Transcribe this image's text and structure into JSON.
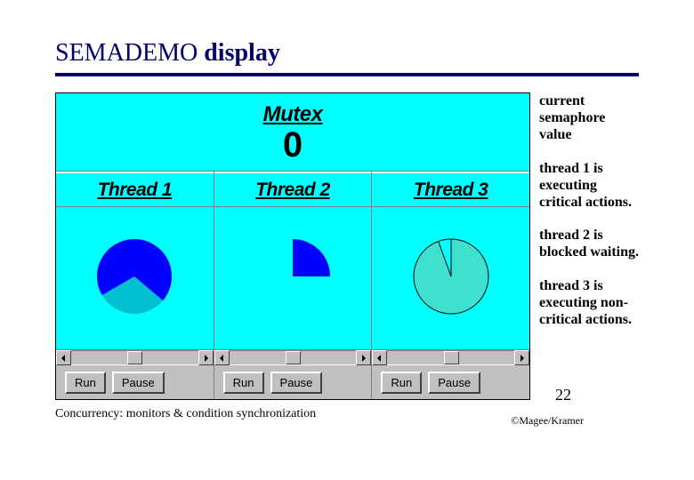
{
  "title": {
    "prefix": "SEMADEMO",
    "suffix": " display"
  },
  "mutex": {
    "label": "Mutex",
    "value": "0"
  },
  "threads": [
    {
      "name": "Thread 1",
      "run": "Run",
      "pause": "Pause",
      "pie": {
        "start": 150,
        "sweep": 250,
        "color": "#0000ff",
        "missing": "#00c0d0",
        "outline": false
      }
    },
    {
      "name": "Thread 2",
      "run": "Run",
      "pause": "Pause",
      "pie": {
        "start": -90,
        "sweep": 90,
        "color": "#0000ff",
        "missing": "transparent",
        "outline": false
      }
    },
    {
      "name": "Thread 3",
      "run": "Run",
      "pause": "Pause",
      "pie": {
        "start": -90,
        "sweep": 340,
        "color": "#40e0d0",
        "missing": "transparent",
        "outline": true
      }
    }
  ],
  "notes": {
    "mutex": "current semaphore value",
    "t1": "thread 1 is executing critical actions.",
    "t2": "thread 2 is blocked waiting.",
    "t3": "thread 3 is executing non-critical actions."
  },
  "footer": {
    "text": "Concurrency: monitors & condition synchronization",
    "page": "22",
    "copyright": "©Magee/Kramer"
  }
}
